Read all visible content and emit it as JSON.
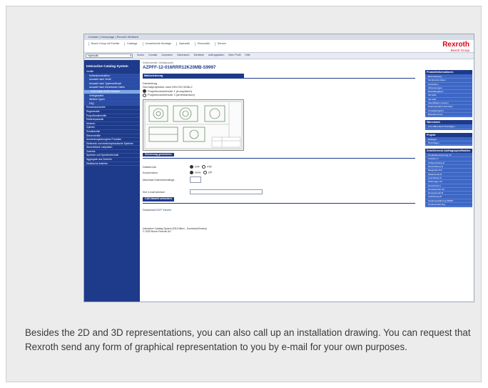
{
  "screenshot": {
    "top_links": "Kontakt | Homepage | Rexroth Weltweit",
    "tabs": [
      "Bosch Group mit Familie",
      "Kataloge",
      "Lineartechnik Montage",
      "Hydraulik",
      "Pneumatik",
      "Service"
    ],
    "logo": {
      "name": "Rexroth",
      "sub": "Bosch Group"
    },
    "dropdown": "Hydraulik",
    "toolbar": [
      "Suche",
      "Kontakt",
      "Anfordern",
      "Warenkorb",
      "Merkliste",
      "Auftragsdaten",
      "Mein Profil",
      "Hilfe"
    ],
    "left_nav": {
      "title": "Interactive Catalog System",
      "items": [
        {
          "label": "Ventile",
          "kind": "top"
        },
        {
          "label": "Kolbenkonstruktion",
          "kind": "sub"
        },
        {
          "label": "Auswahl nach Ventil",
          "kind": "sub"
        },
        {
          "label": "Auswahl nach Typenschlüssel",
          "kind": "sub"
        },
        {
          "label": "Auswahl nach technischen Daten",
          "kind": "sub"
        },
        {
          "label": "CAD-Daten 2D/3D Modelle",
          "kind": "sel"
        },
        {
          "label": "Verfügbarkeit",
          "kind": "sub"
        },
        {
          "label": "Weitere Typen",
          "kind": "sub"
        },
        {
          "label": "FAQ",
          "kind": "sub"
        },
        {
          "label": "Einschraubventile",
          "kind": "top"
        },
        {
          "label": "Regelventile",
          "kind": "top"
        },
        {
          "label": "Proportionalventile",
          "kind": "top"
        },
        {
          "label": "Elektrohydraulik",
          "kind": "top"
        },
        {
          "label": "Motoren",
          "kind": "top"
        },
        {
          "label": "Zylinder",
          "kind": "top"
        },
        {
          "label": "Schaltventile",
          "kind": "top"
        },
        {
          "label": "Steuerventile",
          "kind": "top"
        },
        {
          "label": "Anwendungsbezogene Produkte",
          "kind": "top"
        },
        {
          "label": "Elektronik und elektrohydraulische Systeme",
          "kind": "top"
        },
        {
          "label": "Steuerblöcke Leitplatten",
          "kind": "top"
        },
        {
          "label": "Zubehör",
          "kind": "top"
        },
        {
          "label": "Speicher und Speichertechnik",
          "kind": "top"
        },
        {
          "label": "Aggregate und Zubehör",
          "kind": "top"
        },
        {
          "label": "Elektrische Antriebe",
          "kind": "top"
        }
      ]
    },
    "content": {
      "breadcrumb": "Kolbenventile: Ventilauswahl",
      "title": "AZPFF-12-016RRR12K20MB-S9997",
      "section_bar": "Maßzeichnung",
      "darstellung": "Darstellung",
      "norm": "Normalprojektion nach DIN ISO 5456-2",
      "option1": "Projektionsmethode 1 (europäisch)",
      "option2": "Projektionsmethode 3 (amerikanisch)",
      "generate_button": "Zeichnung generieren",
      "dateiformat_label": "Dateiformat",
      "dateiformat_options": [
        "DXF",
        "PDF"
      ],
      "kompression_label": "Kompression",
      "kompression_options": [
        "keine",
        "ZIP"
      ],
      "maxsize_label": "Maximale Dateinamenlänge",
      "email_label": "Ihre e-mail Adresse",
      "send_button": "CAD-Modell anfordern",
      "download_label": "Download",
      "download_link": "DXF Viewer",
      "footer_line1": "Interactive Catalog System (EN-Edition - Download/Version)",
      "footer_line2": "© 2005 Bosch Rexroth AG"
    },
    "right_nav": [
      {
        "head": "Produktinformationen",
        "items": [
          "Beschreibung",
          "Technische Daten",
          "Kennlinien",
          "Abmessungen",
          "Bestellangaben",
          "2D CAD",
          "3D CAD",
          "Spezifikation senden",
          "Dokumentation Anfordern",
          "Kontaktangebot",
          "Bestellnummer"
        ]
      },
      {
        "head": "Warenkorb",
        "items": [
          "zum Warenkorb hinzufügen"
        ]
      },
      {
        "head": "Projekt",
        "items": [
          "Einfügen",
          "Hinzufügen"
        ]
      },
      {
        "head": "Detaillierende Auftragsspezifikation",
        "items": [
          "Produktbezeichnung 12",
          "Funktion F",
          "Anbaurichtung R",
          "Drehrichtung R",
          "Baugröße 016",
          "Wellenende R",
          "Anschlüsse R",
          "Dichtungen 12",
          "Nenndruck K",
          "Druckbereich 20",
          "Drosselventil M",
          "Ausführung B",
          "Sonderausführung S9997",
          "Kurzbezeichnung"
        ]
      }
    ]
  },
  "caption": "Besides the 2D and 3D representations, you can also call up an installation drawing. You can request that Rexroth send any form of graphical representation to you by e-mail for your own purposes."
}
